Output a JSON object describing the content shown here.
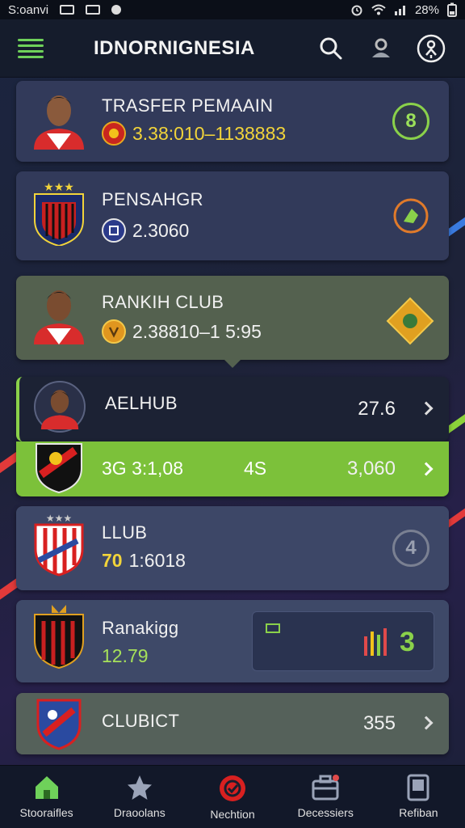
{
  "status_bar": {
    "carrier": "S:oanvi",
    "battery": "28%"
  },
  "app": {
    "title": "IDNORNIGNESIA"
  },
  "cards": [
    {
      "title": "TRASFER PEMAAIN",
      "value": "3.38:010–1138883",
      "badge": "8"
    },
    {
      "title": "PENSAHGR",
      "value": "2.3060"
    },
    {
      "title": "RANKIH CLUB",
      "value": "2.38810–1 5:95"
    },
    {
      "title": "AELHUB",
      "value": "27.6"
    },
    {
      "left": "3G 3:1,08",
      "mid": "4S",
      "right": "3,060"
    },
    {
      "title": "LLUB",
      "value_a": "70",
      "value_b": "1:6018",
      "badge": "4"
    },
    {
      "title": "Ranakigg",
      "value": "12.79",
      "panel_value": "3"
    },
    {
      "title": "CLUBICT",
      "value": "355"
    }
  ],
  "bottom_nav": [
    {
      "label": "Stooraifles",
      "icon": "home-icon"
    },
    {
      "label": "Draoolans",
      "icon": "star-icon"
    },
    {
      "label": "Nechtion",
      "icon": "target-icon"
    },
    {
      "label": "Decessiers",
      "icon": "briefcase-icon"
    },
    {
      "label": "Refiban",
      "icon": "tablet-icon"
    }
  ],
  "colors": {
    "accent_green": "#6fd15a",
    "gold_text": "#f2d43a",
    "lime_text": "#a6e05a"
  }
}
